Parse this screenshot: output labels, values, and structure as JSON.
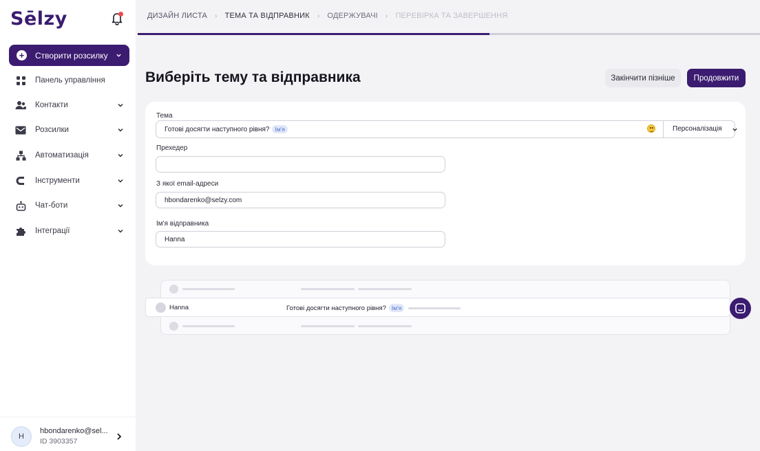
{
  "brand": {
    "logo": "Sēlzy",
    "accent": "#3b1c70"
  },
  "sidebar": {
    "create_label": "Створити розсилку",
    "items": [
      {
        "label": "Панель управління",
        "icon": "dashboard-icon",
        "has_chevron": false
      },
      {
        "label": "Контакти",
        "icon": "contacts-icon",
        "has_chevron": true
      },
      {
        "label": "Розсилки",
        "icon": "mail-icon",
        "has_chevron": true
      },
      {
        "label": "Автоматизація",
        "icon": "automation-icon",
        "has_chevron": true
      },
      {
        "label": "Інструменти",
        "icon": "tools-icon",
        "has_chevron": true
      },
      {
        "label": "Чат-боти",
        "icon": "bot-icon",
        "has_chevron": true
      },
      {
        "label": "Інтеграції",
        "icon": "puzzle-icon",
        "has_chevron": true
      }
    ],
    "user": {
      "initial": "H",
      "email": "hbondarenko@sel...",
      "id": "ID 3903357"
    }
  },
  "stepper": {
    "steps": [
      "ДИЗАЙН ЛИСТА",
      "ТЕМА ТА ВІДПРАВНИК",
      "ОДЕРЖУВАЧІ",
      "ПЕРЕВІРКА ТА ЗАВЕРШЕННЯ"
    ],
    "active_index": 1,
    "progress": 0.565
  },
  "header": {
    "title": "Виберіть тему та відправника",
    "later_label": "Закінчити пізніше",
    "continue_label": "Продовжити"
  },
  "form": {
    "subject_label": "Тема",
    "subject_value": "Готові досягти наступного рівня?",
    "subject_tag": "Ім'я",
    "personalization_label": "Персоналізація",
    "preheader_label": "Прехедер",
    "preheader_value": "",
    "from_email_label": "З якої email-адреси",
    "from_email_value": "hbondarenko@selzy.com",
    "sender_name_label": "Ім'я відправника",
    "sender_name_value": "Hanna"
  },
  "preview": {
    "sender": "Hanna",
    "subject": "Готові досягти наступного рівня?",
    "subject_tag": "Ім'я"
  }
}
